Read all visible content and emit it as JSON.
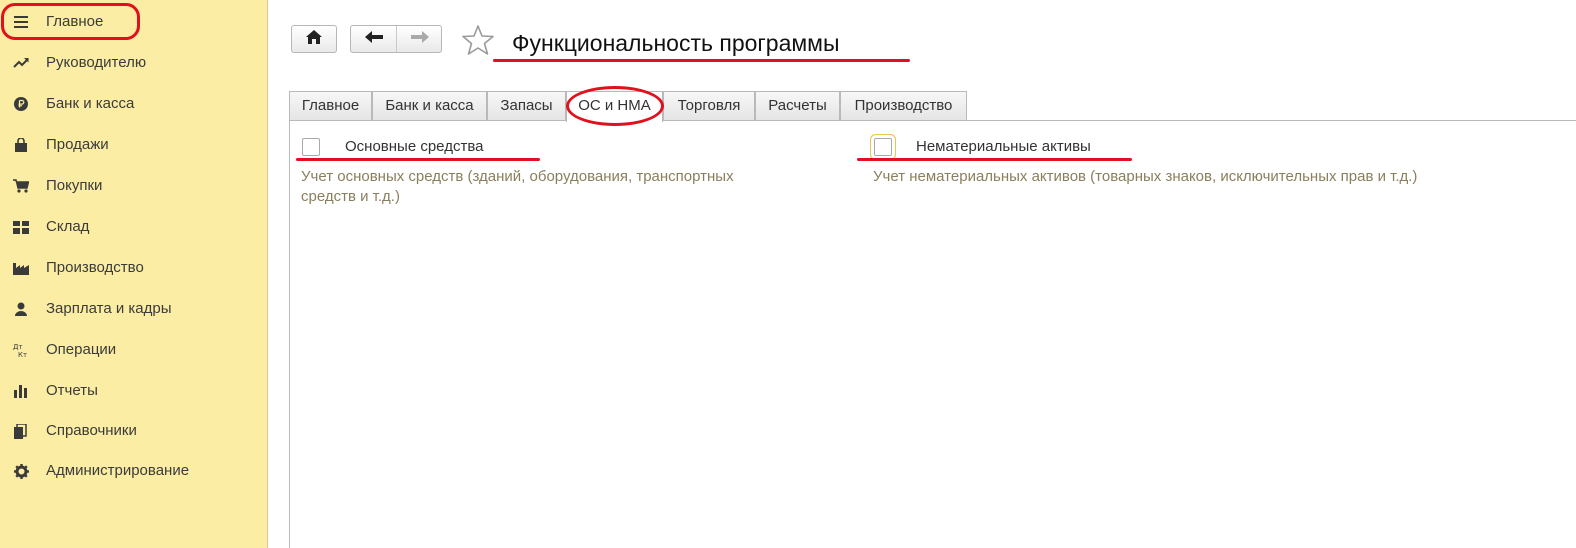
{
  "sidebar": {
    "items": [
      {
        "label": "Главное",
        "icon": "menu-icon"
      },
      {
        "label": "Руководителю",
        "icon": "trend-icon"
      },
      {
        "label": "Банк и касса",
        "icon": "ruble-icon"
      },
      {
        "label": "Продажи",
        "icon": "bag-icon"
      },
      {
        "label": "Покупки",
        "icon": "cart-icon"
      },
      {
        "label": "Склад",
        "icon": "warehouse-icon"
      },
      {
        "label": "Производство",
        "icon": "factory-icon"
      },
      {
        "label": "Зарплата и кадры",
        "icon": "person-icon"
      },
      {
        "label": "Операции",
        "icon": "dt-kt-icon"
      },
      {
        "label": "Отчеты",
        "icon": "bar-chart-icon"
      },
      {
        "label": "Справочники",
        "icon": "books-icon"
      },
      {
        "label": "Администрирование",
        "icon": "gear-icon"
      }
    ]
  },
  "toolbar": {
    "home_icon": "home-icon",
    "back_icon": "arrow-left-icon",
    "forward_icon": "arrow-right-icon",
    "favorite_icon": "star-icon"
  },
  "header": {
    "title": "Функциональность программы"
  },
  "tabs": [
    {
      "label": "Главное"
    },
    {
      "label": "Банк и касса"
    },
    {
      "label": "Запасы"
    },
    {
      "label": "ОС и НМА",
      "active": true
    },
    {
      "label": "Торговля"
    },
    {
      "label": "Расчеты"
    },
    {
      "label": "Производство"
    }
  ],
  "options": {
    "fixed_assets": {
      "label": "Основные средства",
      "description": "Учет основных средств (зданий, оборудования, транспортных средств и т.д.)",
      "checked": false
    },
    "intangible_assets": {
      "label": "Нематериальные активы",
      "description": "Учет нематериальных активов (товарных знаков, исключительных прав и т.д.)",
      "checked": false
    }
  },
  "colors": {
    "sidebar_bg": "#fbeda4",
    "annotation_red": "#e0101c",
    "description_text": "#8a7f5d"
  }
}
